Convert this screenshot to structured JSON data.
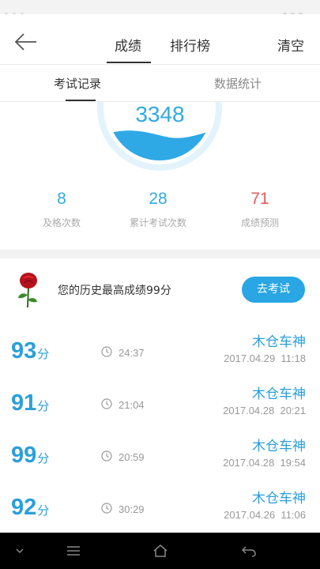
{
  "header": {
    "back_icon": "arrow-left-icon",
    "tabs": [
      {
        "label": "成绩",
        "active": true
      },
      {
        "label": "排行榜",
        "active": false
      }
    ],
    "clear_label": "清空"
  },
  "sub_tabs": [
    {
      "label": "考试记录",
      "active": true
    },
    {
      "label": "数据统计",
      "active": false
    }
  ],
  "summary": {
    "gauge_value": "3348",
    "stats": [
      {
        "value": "8",
        "label": "及格次数",
        "color": "#33a9e4"
      },
      {
        "value": "28",
        "label": "累计考试次数",
        "color": "#33a9e4"
      },
      {
        "value": "71",
        "label": "成绩预测",
        "color": "#e55d5d"
      }
    ]
  },
  "best": {
    "icon": "rose-icon",
    "text": "您的历史最高成绩99分",
    "button_label": "去考试"
  },
  "records": [
    {
      "score": "93",
      "unit": "分",
      "duration": "24:37",
      "label": "木仓车神",
      "date": "2017.04.29  11:18"
    },
    {
      "score": "91",
      "unit": "分",
      "duration": "21:04",
      "label": "木仓车神",
      "date": "2017.04.28  20:21"
    },
    {
      "score": "99",
      "unit": "分",
      "duration": "20:59",
      "label": "木仓车神",
      "date": "2017.04.28  19:54"
    },
    {
      "score": "92",
      "unit": "分",
      "duration": "30:29",
      "label": "木仓车神",
      "date": "2017.04.26  11:06"
    }
  ],
  "colors": {
    "accent": "#29a6e3",
    "danger": "#e55d5d"
  },
  "system_nav": [
    "chevron-down-icon",
    "menu-icon",
    "home-icon",
    "back-icon"
  ]
}
